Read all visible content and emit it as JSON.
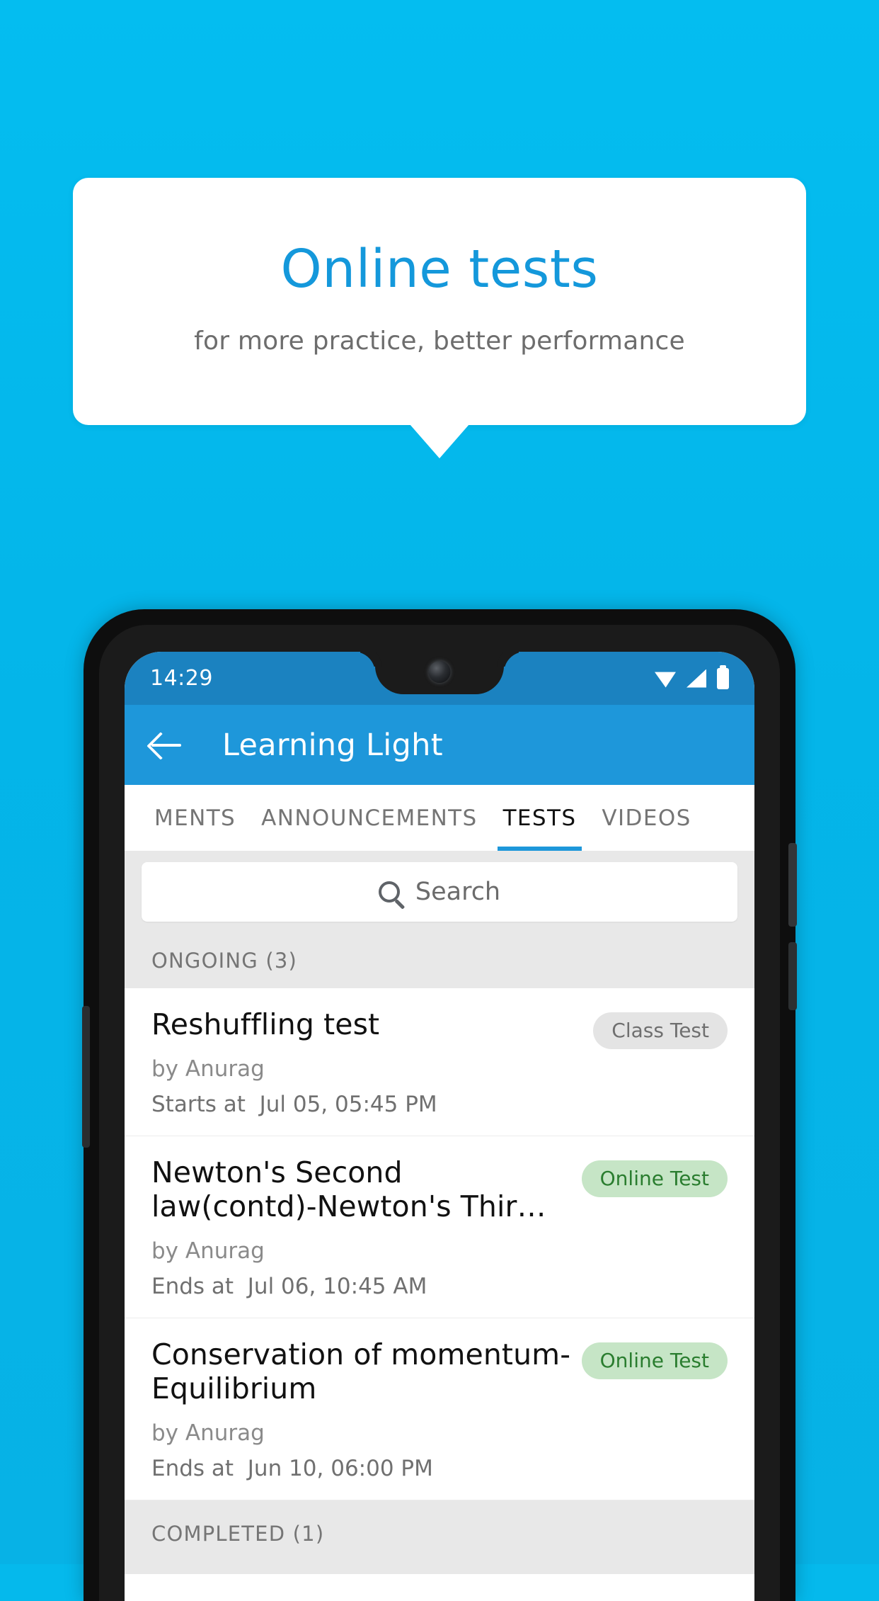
{
  "promo": {
    "title": "Online tests",
    "subtitle": "for more practice, better performance"
  },
  "colors": {
    "background": "#04bdf0",
    "accent": "#1e97da",
    "statusbar": "#1b82c0",
    "badge_online_bg": "#c6e5c6",
    "badge_online_text": "#2a7d2f",
    "badge_class_bg": "#e4e4e4",
    "badge_class_text": "#6f6f6f"
  },
  "phone": {
    "statusbar": {
      "clock": "14:29",
      "icons": [
        "wifi-icon",
        "signal-icon",
        "battery-icon"
      ]
    },
    "appbar": {
      "back_icon": "back-arrow-icon",
      "title": "Learning Light"
    },
    "tabs": [
      {
        "label": "MENTS",
        "active": false
      },
      {
        "label": "ANNOUNCEMENTS",
        "active": false
      },
      {
        "label": "TESTS",
        "active": true
      },
      {
        "label": "VIDEOS",
        "active": false
      }
    ],
    "search": {
      "icon": "search-icon",
      "placeholder": "Search",
      "value": ""
    },
    "sections": [
      {
        "heading": "ONGOING (3)",
        "items": [
          {
            "title": "Reshuffling test",
            "author": "by Anurag",
            "schedule": "Starts at  Jul 05, 05:45 PM",
            "badge": "Class Test",
            "badge_style": "grey"
          },
          {
            "title": "Newton's Second law(contd)-Newton's Thir…",
            "author": "by Anurag",
            "schedule": "Ends at  Jul 06, 10:45 AM",
            "badge": "Online Test",
            "badge_style": "green"
          },
          {
            "title": "Conservation of momentum-Equilibrium",
            "author": "by Anurag",
            "schedule": "Ends at  Jun 10, 06:00 PM",
            "badge": "Online Test",
            "badge_style": "green"
          }
        ]
      },
      {
        "heading": "COMPLETED (1)",
        "items": []
      }
    ]
  }
}
